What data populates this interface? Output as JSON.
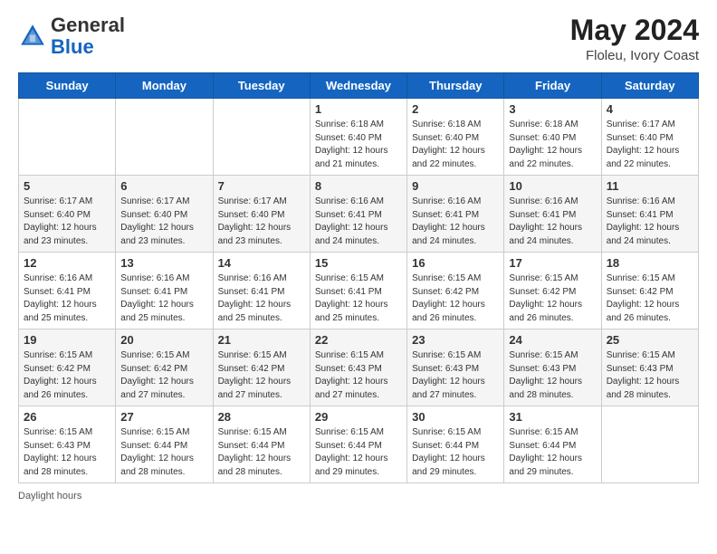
{
  "header": {
    "logo_general": "General",
    "logo_blue": "Blue",
    "month_title": "May 2024",
    "location": "Floleu, Ivory Coast"
  },
  "days_of_week": [
    "Sunday",
    "Monday",
    "Tuesday",
    "Wednesday",
    "Thursday",
    "Friday",
    "Saturday"
  ],
  "weeks": [
    [
      {
        "day": "",
        "info": ""
      },
      {
        "day": "",
        "info": ""
      },
      {
        "day": "",
        "info": ""
      },
      {
        "day": "1",
        "sunrise": "6:18 AM",
        "sunset": "6:40 PM",
        "daylight": "12 hours and 21 minutes."
      },
      {
        "day": "2",
        "sunrise": "6:18 AM",
        "sunset": "6:40 PM",
        "daylight": "12 hours and 22 minutes."
      },
      {
        "day": "3",
        "sunrise": "6:18 AM",
        "sunset": "6:40 PM",
        "daylight": "12 hours and 22 minutes."
      },
      {
        "day": "4",
        "sunrise": "6:17 AM",
        "sunset": "6:40 PM",
        "daylight": "12 hours and 22 minutes."
      }
    ],
    [
      {
        "day": "5",
        "sunrise": "6:17 AM",
        "sunset": "6:40 PM",
        "daylight": "12 hours and 23 minutes."
      },
      {
        "day": "6",
        "sunrise": "6:17 AM",
        "sunset": "6:40 PM",
        "daylight": "12 hours and 23 minutes."
      },
      {
        "day": "7",
        "sunrise": "6:17 AM",
        "sunset": "6:40 PM",
        "daylight": "12 hours and 23 minutes."
      },
      {
        "day": "8",
        "sunrise": "6:16 AM",
        "sunset": "6:41 PM",
        "daylight": "12 hours and 24 minutes."
      },
      {
        "day": "9",
        "sunrise": "6:16 AM",
        "sunset": "6:41 PM",
        "daylight": "12 hours and 24 minutes."
      },
      {
        "day": "10",
        "sunrise": "6:16 AM",
        "sunset": "6:41 PM",
        "daylight": "12 hours and 24 minutes."
      },
      {
        "day": "11",
        "sunrise": "6:16 AM",
        "sunset": "6:41 PM",
        "daylight": "12 hours and 24 minutes."
      }
    ],
    [
      {
        "day": "12",
        "sunrise": "6:16 AM",
        "sunset": "6:41 PM",
        "daylight": "12 hours and 25 minutes."
      },
      {
        "day": "13",
        "sunrise": "6:16 AM",
        "sunset": "6:41 PM",
        "daylight": "12 hours and 25 minutes."
      },
      {
        "day": "14",
        "sunrise": "6:16 AM",
        "sunset": "6:41 PM",
        "daylight": "12 hours and 25 minutes."
      },
      {
        "day": "15",
        "sunrise": "6:15 AM",
        "sunset": "6:41 PM",
        "daylight": "12 hours and 25 minutes."
      },
      {
        "day": "16",
        "sunrise": "6:15 AM",
        "sunset": "6:42 PM",
        "daylight": "12 hours and 26 minutes."
      },
      {
        "day": "17",
        "sunrise": "6:15 AM",
        "sunset": "6:42 PM",
        "daylight": "12 hours and 26 minutes."
      },
      {
        "day": "18",
        "sunrise": "6:15 AM",
        "sunset": "6:42 PM",
        "daylight": "12 hours and 26 minutes."
      }
    ],
    [
      {
        "day": "19",
        "sunrise": "6:15 AM",
        "sunset": "6:42 PM",
        "daylight": "12 hours and 26 minutes."
      },
      {
        "day": "20",
        "sunrise": "6:15 AM",
        "sunset": "6:42 PM",
        "daylight": "12 hours and 27 minutes."
      },
      {
        "day": "21",
        "sunrise": "6:15 AM",
        "sunset": "6:42 PM",
        "daylight": "12 hours and 27 minutes."
      },
      {
        "day": "22",
        "sunrise": "6:15 AM",
        "sunset": "6:43 PM",
        "daylight": "12 hours and 27 minutes."
      },
      {
        "day": "23",
        "sunrise": "6:15 AM",
        "sunset": "6:43 PM",
        "daylight": "12 hours and 27 minutes."
      },
      {
        "day": "24",
        "sunrise": "6:15 AM",
        "sunset": "6:43 PM",
        "daylight": "12 hours and 28 minutes."
      },
      {
        "day": "25",
        "sunrise": "6:15 AM",
        "sunset": "6:43 PM",
        "daylight": "12 hours and 28 minutes."
      }
    ],
    [
      {
        "day": "26",
        "sunrise": "6:15 AM",
        "sunset": "6:43 PM",
        "daylight": "12 hours and 28 minutes."
      },
      {
        "day": "27",
        "sunrise": "6:15 AM",
        "sunset": "6:44 PM",
        "daylight": "12 hours and 28 minutes."
      },
      {
        "day": "28",
        "sunrise": "6:15 AM",
        "sunset": "6:44 PM",
        "daylight": "12 hours and 28 minutes."
      },
      {
        "day": "29",
        "sunrise": "6:15 AM",
        "sunset": "6:44 PM",
        "daylight": "12 hours and 29 minutes."
      },
      {
        "day": "30",
        "sunrise": "6:15 AM",
        "sunset": "6:44 PM",
        "daylight": "12 hours and 29 minutes."
      },
      {
        "day": "31",
        "sunrise": "6:15 AM",
        "sunset": "6:44 PM",
        "daylight": "12 hours and 29 minutes."
      },
      {
        "day": "",
        "info": ""
      }
    ]
  ],
  "footer": {
    "daylight_label": "Daylight hours"
  }
}
